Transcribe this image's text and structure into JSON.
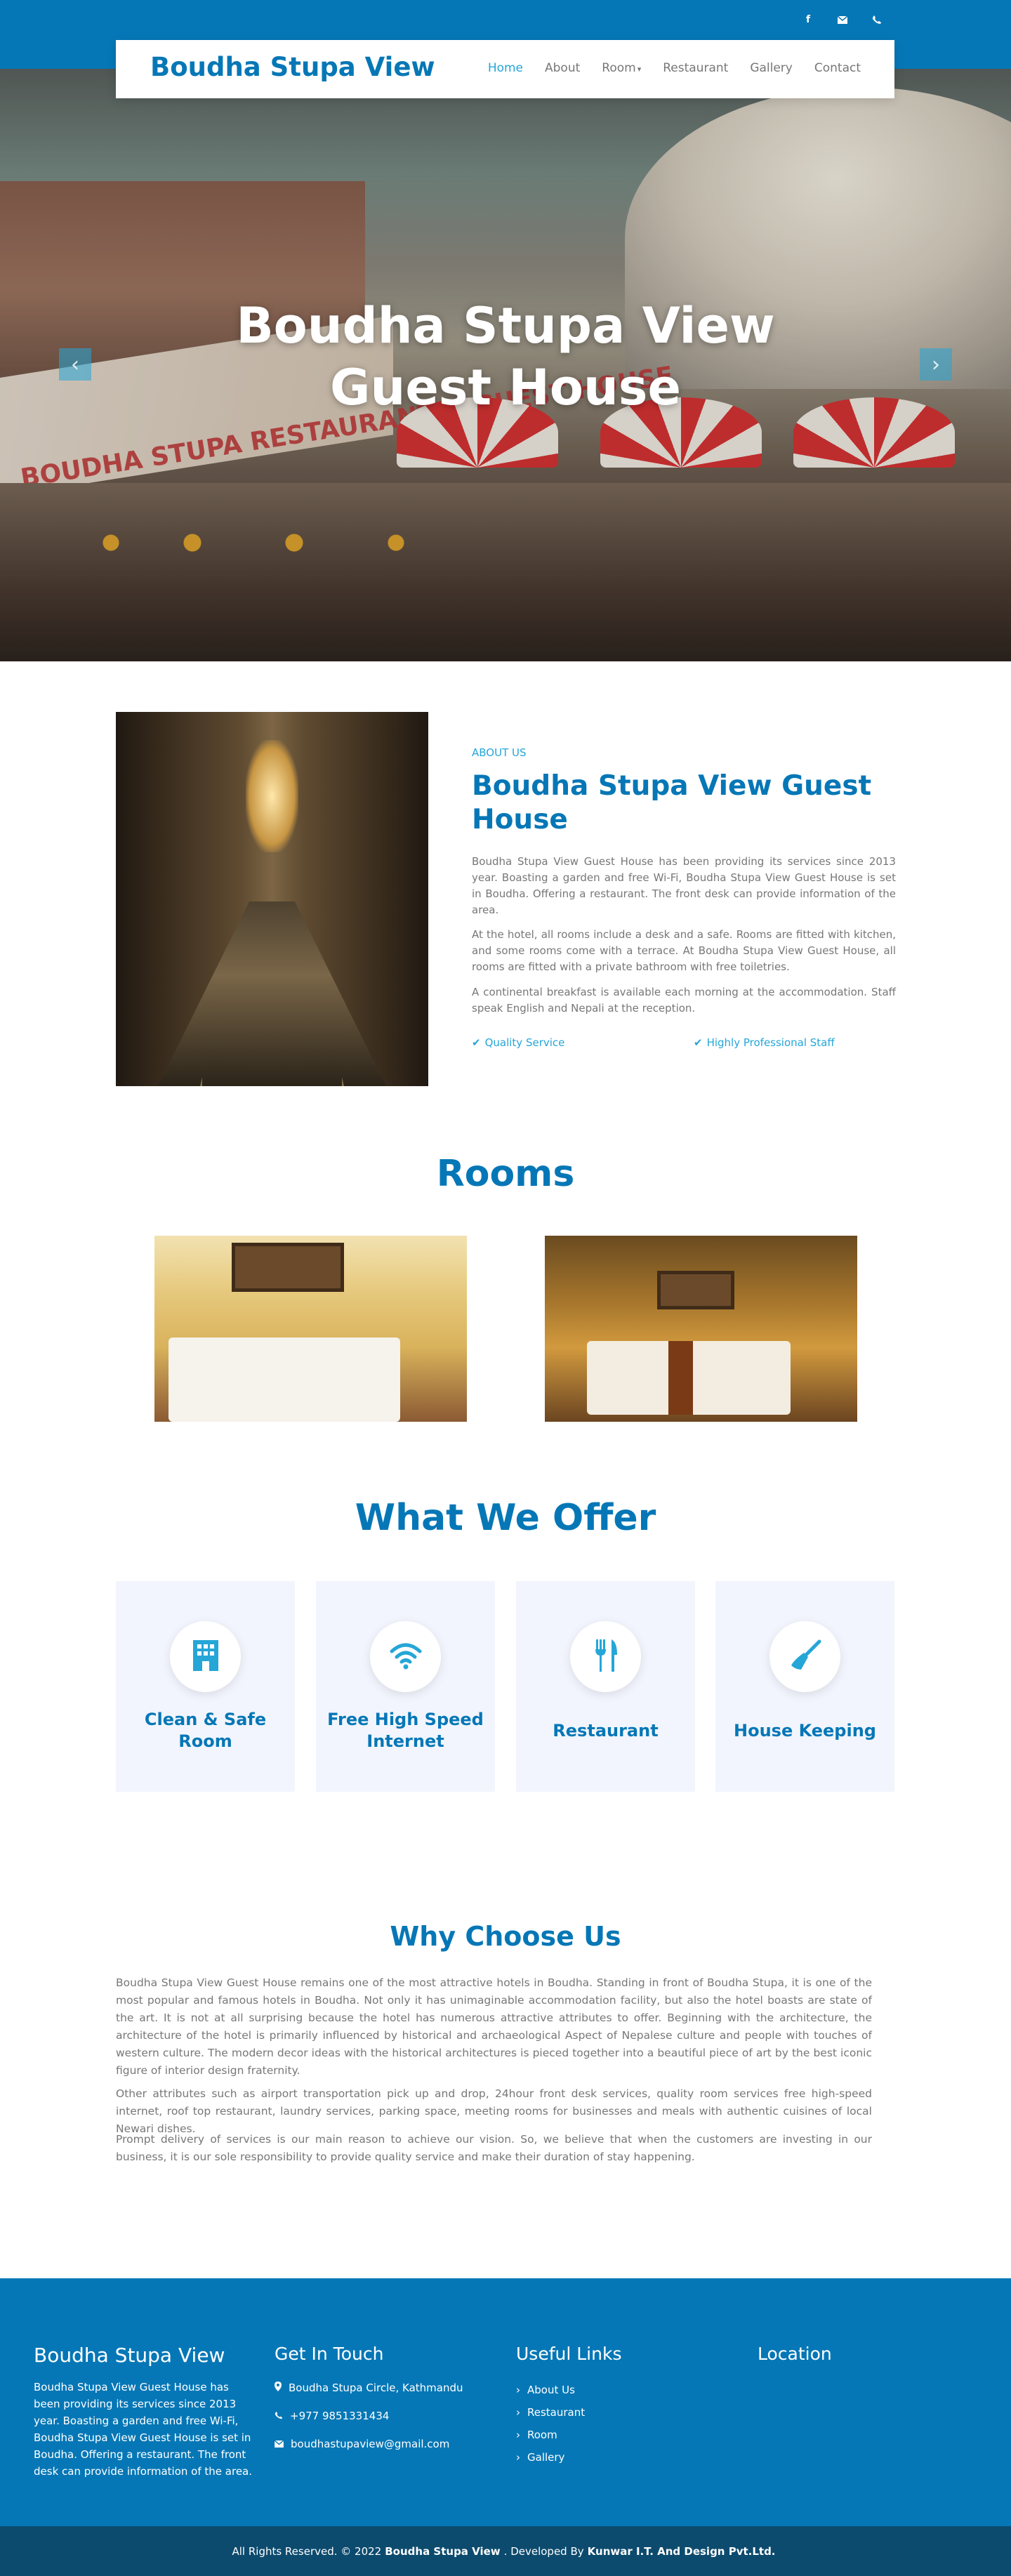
{
  "header": {
    "brand": "Boudha Stupa View",
    "social": [
      "facebook-icon",
      "envelope-icon",
      "phone-icon"
    ],
    "menu": [
      {
        "label": "Home",
        "active": true
      },
      {
        "label": "About"
      },
      {
        "label": "Room",
        "caret": "▾"
      },
      {
        "label": "Restaurant"
      },
      {
        "label": "Gallery"
      },
      {
        "label": "Contact"
      }
    ]
  },
  "hero": {
    "title_line1": "Boudha Stupa View",
    "title_line2": "Guest House",
    "sign_text": "BOUDHA STUPA RESTAURANT & GUEST HOUSE",
    "prev": "‹",
    "next": "›"
  },
  "about": {
    "tag": "ABOUT US",
    "title": "Boudha Stupa View Guest House",
    "p1": "Boudha Stupa View Guest House has been providing its services since 2013 year. Boasting a garden and free Wi-Fi, Boudha Stupa View Guest House is set in Boudha. Offering a restaurant. The front desk can provide information of the area.",
    "p2": "At the hotel, all rooms include a desk and a safe. Rooms are fitted with kitchen, and some rooms come with a terrace. At Boudha Stupa View Guest House, all rooms are fitted with a private bathroom with free toiletries.",
    "p3": "A continental breakfast is available each morning at the accommodation. Staff speak English and Nepali at the reception.",
    "check1": "Quality Service",
    "check2": "Highly Professional Staff"
  },
  "rooms": {
    "title": "Rooms"
  },
  "offer": {
    "title": "What We Offer",
    "items": [
      {
        "label": "Clean & Safe Room",
        "icon": "building-icon"
      },
      {
        "label": "Free High Speed Internet",
        "icon": "wifi-icon"
      },
      {
        "label": "Restaurant",
        "icon": "utensils-icon"
      },
      {
        "label": "House Keeping",
        "icon": "broom-icon"
      }
    ]
  },
  "why": {
    "title": "Why Choose Us",
    "p1": "Boudha Stupa View Guest House remains one of the most attractive hotels in Boudha. Standing in front of Boudha Stupa, it is one of the most popular and famous hotels in Boudha. Not only it has unimaginable accommodation facility, but also the hotel boasts are state of the art. It is not at all surprising because the hotel has numerous attractive attributes to offer. Beginning with the architecture, the architecture of the hotel is primarily influenced by historical and archaeological Aspect of Nepalese culture and people with touches of western culture. The modern decor ideas with the historical architectures is pieced together into a beautiful piece of art by the best iconic figure of interior design fraternity.",
    "p2": "Other attributes such as airport transportation pick up and drop, 24hour front desk services, quality room services free high-speed internet, roof top restaurant, laundry services, parking space, meeting rooms for businesses and meals with authentic cuisines of local Newari dishes.",
    "p3": "Prompt delivery of services is our main reason to achieve our vision. So, we believe that when the customers are investing in our business, it is our sole responsibility to provide quality service and make their duration of stay happening."
  },
  "footer": {
    "brand": "Boudha Stupa View",
    "brand_text": "Boudha Stupa View Guest House has been providing its services since 2013 year. Boasting a garden and free Wi-Fi, Boudha Stupa View Guest House is set in Boudha. Offering a restaurant. The front desk can provide information of the area.",
    "contact_title": "Get In Touch",
    "address": "Boudha Stupa Circle, Kathmandu",
    "phone": "+977 9851331434",
    "email": "boudhastupaview@gmail.com",
    "links_title": "Useful Links",
    "links": [
      "About Us",
      "Restaurant",
      "Room",
      "Gallery"
    ],
    "location_title": "Location"
  },
  "copyright": {
    "prefix": "All Rights Reserved. © 2022",
    "site": "Boudha Stupa View",
    "middle": ". Developed By",
    "dev": "Kunwar I.T. And Design Pvt.Ltd."
  },
  "colors": {
    "primary": "#0677b6",
    "accent": "#25a6d7",
    "card": "#f2f5fd",
    "bottombar": "#0d4b6e"
  }
}
